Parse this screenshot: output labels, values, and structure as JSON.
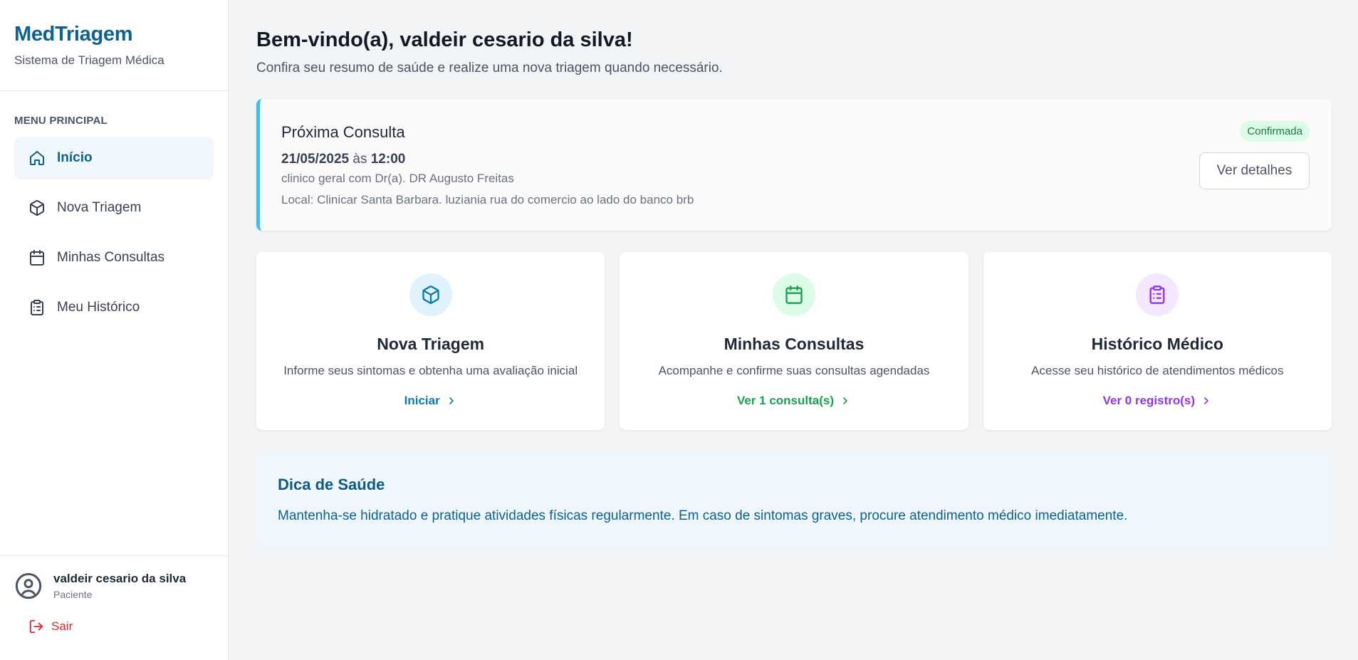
{
  "sidebar": {
    "brand_title": "MedTriagem",
    "brand_subtitle": "Sistema de Triagem Médica",
    "menu_label": "MENU PRINCIPAL",
    "items": [
      {
        "label": "Início",
        "icon": "home-icon",
        "active": true
      },
      {
        "label": "Nova Triagem",
        "icon": "box-icon",
        "active": false
      },
      {
        "label": "Minhas Consultas",
        "icon": "calendar-icon",
        "active": false
      },
      {
        "label": "Meu Histórico",
        "icon": "clipboard-icon",
        "active": false
      }
    ],
    "user": {
      "name": "valdeir cesario da silva",
      "role": "Paciente",
      "icon": "user-circle-icon"
    },
    "logout_label": "Sair"
  },
  "main": {
    "welcome": "Bem-vindo(a), valdeir cesario da silva!",
    "welcome_sub": "Confira seu resumo de saúde e realize uma nova triagem quando necessário.",
    "appointment": {
      "title": "Próxima Consulta",
      "date": "21/05/2025",
      "at": "às",
      "time": "12:00",
      "doctor_line": "clinico geral com Dr(a). DR Augusto Freitas",
      "location_line": "Local: Clinicar Santa Barbara. luziania rua do comercio ao lado do banco brb",
      "status": "Confirmada",
      "details_button": "Ver detalhes"
    },
    "cards": [
      {
        "title": "Nova Triagem",
        "desc": "Informe seus sintomas e obtenha uma avaliação inicial",
        "link": "Iniciar",
        "icon": "box-icon",
        "color": "#0c7bb3",
        "bg": "#e0f2fe"
      },
      {
        "title": "Minhas Consultas",
        "desc": "Acompanhe e confirme suas consultas agendadas",
        "link": "Ver 1 consulta(s)",
        "icon": "calendar-icon",
        "color": "#16a34a",
        "bg": "#dcfce7"
      },
      {
        "title": "Histórico Médico",
        "desc": "Acesse seu histórico de atendimentos médicos",
        "link": "Ver 0 registro(s)",
        "icon": "clipboard-icon",
        "color": "#9333ea",
        "bg": "#f3e8ff"
      }
    ],
    "tip": {
      "title": "Dica de Saúde",
      "text": "Mantenha-se hidratado e pratique atividades físicas regularmente. Em caso de sintomas graves, procure atendimento médico imediatamente."
    }
  },
  "colors": {
    "brand": "#0c6291",
    "accent_border": "#38bdf8",
    "danger": "#dc2626"
  }
}
